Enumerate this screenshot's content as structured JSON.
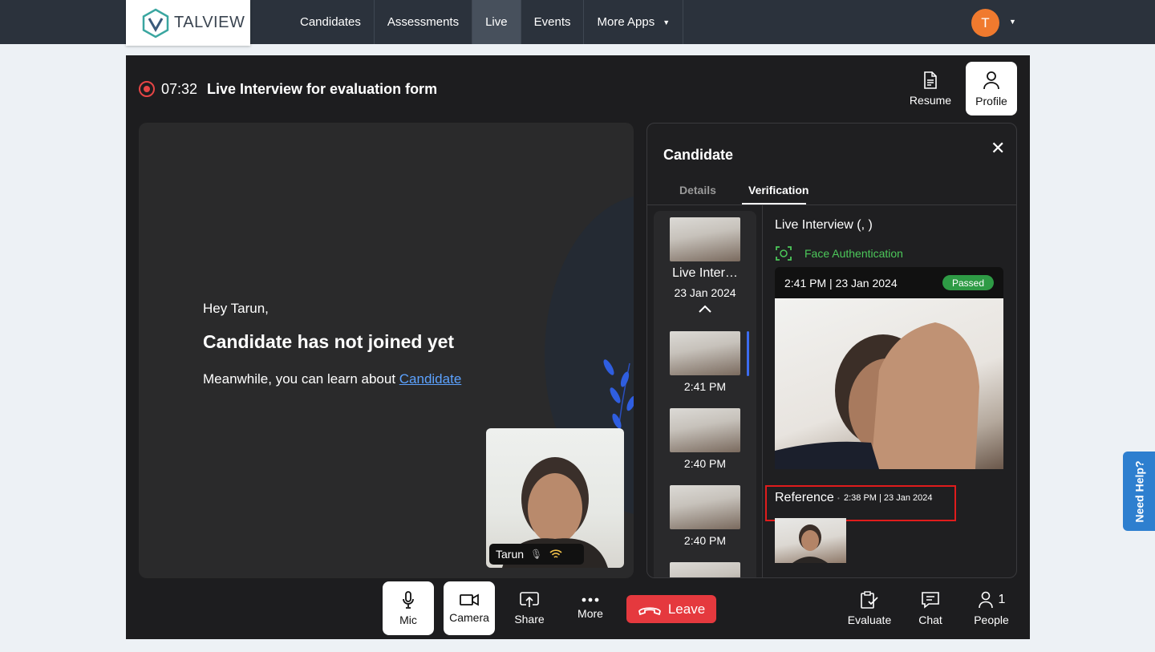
{
  "brand": {
    "name": "TALVIEW"
  },
  "nav": {
    "items": [
      {
        "label": "Candidates"
      },
      {
        "label": "Assessments"
      },
      {
        "label": "Live"
      },
      {
        "label": "Events"
      },
      {
        "label": "More Apps"
      }
    ],
    "active": "Live"
  },
  "user": {
    "initial": "T"
  },
  "meeting": {
    "timer": "07:32",
    "title": "Live Interview for evaluation form",
    "resume_label": "Resume",
    "profile_label": "Profile"
  },
  "main_video": {
    "greeting": "Hey Tarun,",
    "status": "Candidate has not joined yet",
    "meanwhile": "Meanwhile, you can learn about ",
    "link": "Candidate"
  },
  "self_view": {
    "name": "Tarun"
  },
  "panel": {
    "title": "Candidate",
    "tabs": [
      {
        "label": "Details"
      },
      {
        "label": "Verification"
      }
    ],
    "active_tab": "Verification",
    "sidebar": {
      "group_title": "Live Inter…",
      "group_date": "23 Jan 2024",
      "items": [
        {
          "time": "2:41 PM"
        },
        {
          "time": "2:40 PM"
        },
        {
          "time": "2:40 PM"
        }
      ]
    },
    "detail": {
      "title": "Live Interview (, )",
      "check_label": "Face Authentication",
      "card_time": "2:41 PM",
      "card_date": "23 Jan 2024",
      "card_status": "Passed",
      "reference_label": "Reference",
      "reference_time": "2:38 PM | 23 Jan 2024"
    }
  },
  "controls": {
    "mic": "Mic",
    "camera": "Camera",
    "share": "Share",
    "more": "More",
    "leave": "Leave",
    "evaluate": "Evaluate",
    "chat": "Chat",
    "people": "People",
    "people_count": "1"
  },
  "help": {
    "label": "Need Help?"
  },
  "colors": {
    "accent": "#e5393e",
    "passed": "#2e9b45",
    "face_auth": "#4cc85a",
    "highlight_box": "#e01c1c",
    "avatar": "#f07a2e"
  }
}
